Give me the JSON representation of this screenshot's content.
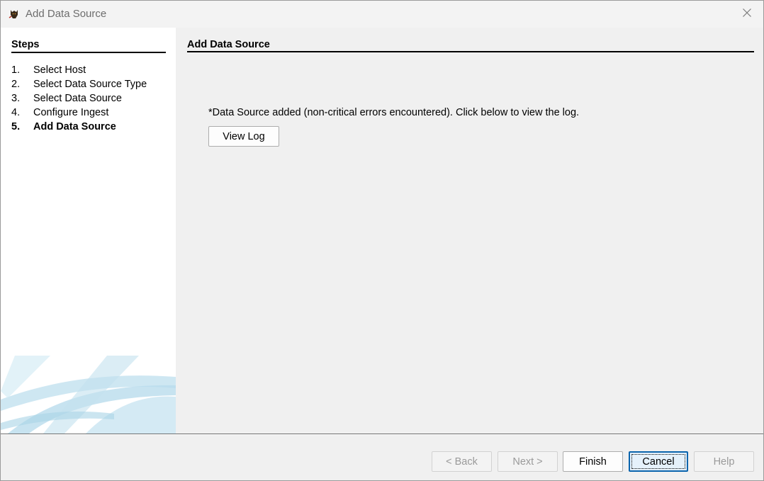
{
  "window": {
    "title": "Add Data Source"
  },
  "steps": {
    "title": "Steps",
    "items": [
      {
        "num": "1.",
        "label": "Select Host"
      },
      {
        "num": "2.",
        "label": "Select Data Source Type"
      },
      {
        "num": "3.",
        "label": "Select Data Source"
      },
      {
        "num": "4.",
        "label": "Configure Ingest"
      },
      {
        "num": "5.",
        "label": "Add Data Source"
      }
    ],
    "current_index": 4
  },
  "main": {
    "title": "Add Data Source",
    "message": "*Data Source added (non-critical errors encountered). Click below to view the log.",
    "view_log_label": "View Log"
  },
  "footer": {
    "back_label": "< Back",
    "next_label": "Next >",
    "finish_label": "Finish",
    "cancel_label": "Cancel",
    "help_label": "Help"
  },
  "icons": {
    "app": "app-logo-icon",
    "close": "close-icon"
  },
  "colors": {
    "accent": "#0a64ad",
    "swoosh": "#b9dcec"
  }
}
